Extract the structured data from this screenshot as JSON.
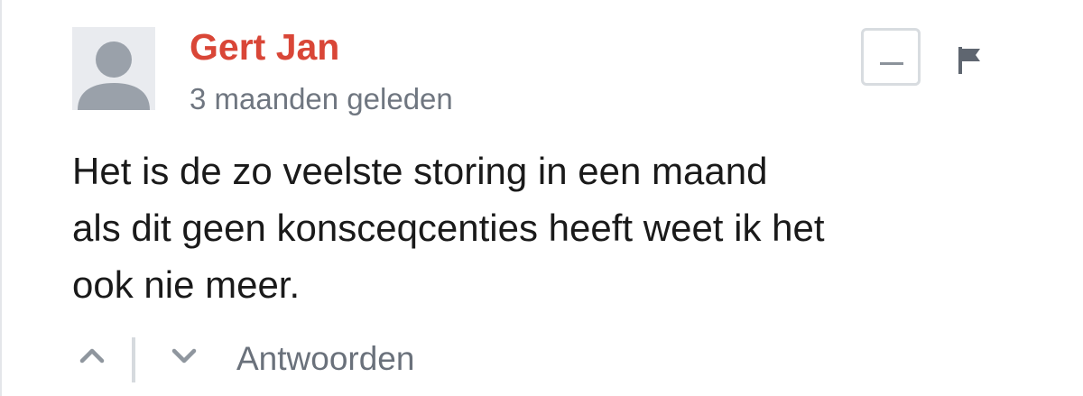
{
  "comment": {
    "author": "Gert Jan",
    "timestamp": "3 maanden geleden",
    "body_lines": [
      "Het is de zo veelste storing in een maand",
      "als dit geen konsceqcenties heeft weet ik het",
      "ook nie meer."
    ],
    "actions": {
      "reply_label": "Antwoorden"
    }
  },
  "icons": {
    "avatar": "user-silhouette-icon",
    "collapse": "minus-icon",
    "flag": "flag-icon",
    "upvote": "chevron-up-icon",
    "downvote": "chevron-down-icon"
  },
  "colors": {
    "author": "#d94637",
    "muted_text": "#6f7680",
    "body_text": "#1a1a1a",
    "avatar_bg": "#e9ebef",
    "avatar_fg": "#9aa1aa"
  }
}
